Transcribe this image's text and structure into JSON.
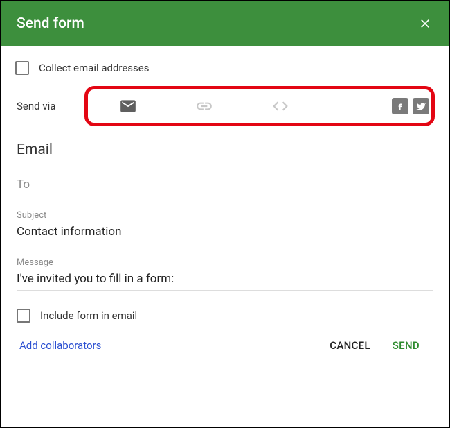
{
  "header": {
    "title": "Send form"
  },
  "collectEmails": {
    "label": "Collect email addresses"
  },
  "sendVia": {
    "label": "Send via"
  },
  "section": {
    "title": "Email"
  },
  "fields": {
    "to": {
      "label": "To",
      "value": ""
    },
    "subject": {
      "label": "Subject",
      "value": "Contact information"
    },
    "message": {
      "label": "Message",
      "value": "I've invited you to fill in a form:"
    }
  },
  "includeForm": {
    "label": "Include form in email"
  },
  "footer": {
    "addCollab": "Add collaborators",
    "cancel": "CANCEL",
    "send": "SEND"
  }
}
